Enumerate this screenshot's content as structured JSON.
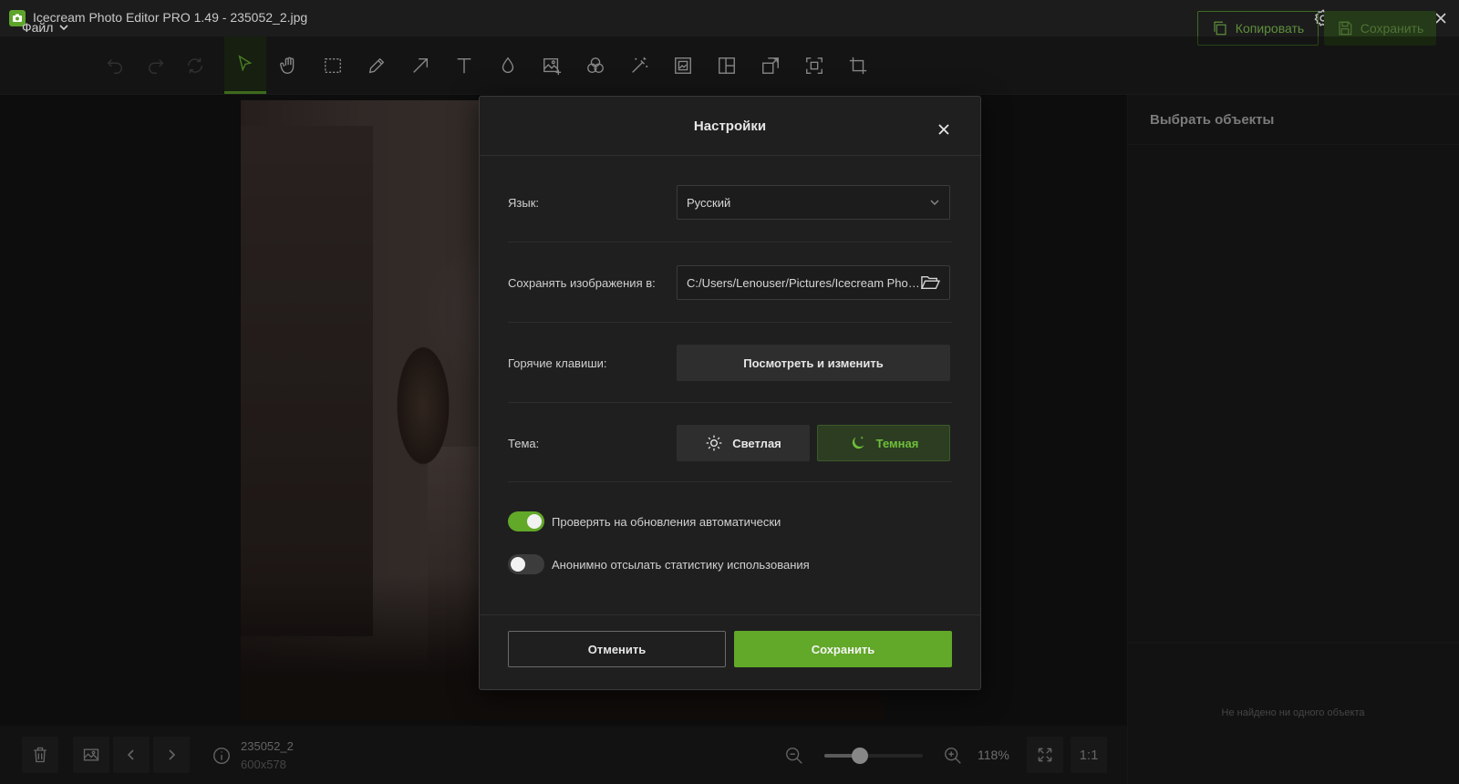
{
  "window": {
    "title": "Icecream Photo Editor PRO 1.49 - 235052_2.jpg",
    "icons": [
      "camera-icon",
      "gear-icon",
      "minimize-icon",
      "restore-icon",
      "close-icon"
    ]
  },
  "toolbar": {
    "file_menu": "Файл",
    "tools": [
      "undo-icon",
      "redo-icon",
      "reset-icon",
      "select-icon",
      "hand-icon",
      "marquee-icon",
      "pencil-icon",
      "arrow-icon",
      "text-icon",
      "drop-icon",
      "image-add-icon",
      "filters-icon",
      "magic-wand-icon",
      "frame-icon",
      "collage-icon",
      "resize-icon",
      "crop-select-icon",
      "crop-icon"
    ],
    "active_tool": "select-icon",
    "copy_label": "Копировать",
    "save_label": "Сохранить"
  },
  "right_panel": {
    "title": "Выбрать объекты",
    "empty_text": "Не найдено ни одного объекта"
  },
  "bottom": {
    "file_name": "235052_2",
    "file_size": "600x578",
    "zoom_level": "118%",
    "zoom_slider_percent": 35,
    "one_to_one": "1:1"
  },
  "dialog": {
    "title": "Настройки",
    "language_label": "Язык:",
    "language_value": "Русский",
    "save_path_label": "Сохранять изображения в:",
    "save_path_value": "C:/Users/Lenouser/Pictures/Icecream Photo Editor",
    "hotkeys_label": "Горячие клавиши:",
    "hotkeys_button": "Посмотреть и изменить",
    "theme_label": "Тема:",
    "theme_light": "Светлая",
    "theme_dark": "Темная",
    "theme_selected": "dark",
    "auto_update_label": "Проверять на обновления автоматически",
    "auto_update_on": true,
    "stats_label": "Анонимно отсылать статистику использования",
    "stats_on": false,
    "cancel_label": "Отменить",
    "save_label": "Сохранить"
  },
  "colors": {
    "accent": "#62a829",
    "background": "#1a1a1a",
    "dialog_bg": "#1f1f1f"
  }
}
